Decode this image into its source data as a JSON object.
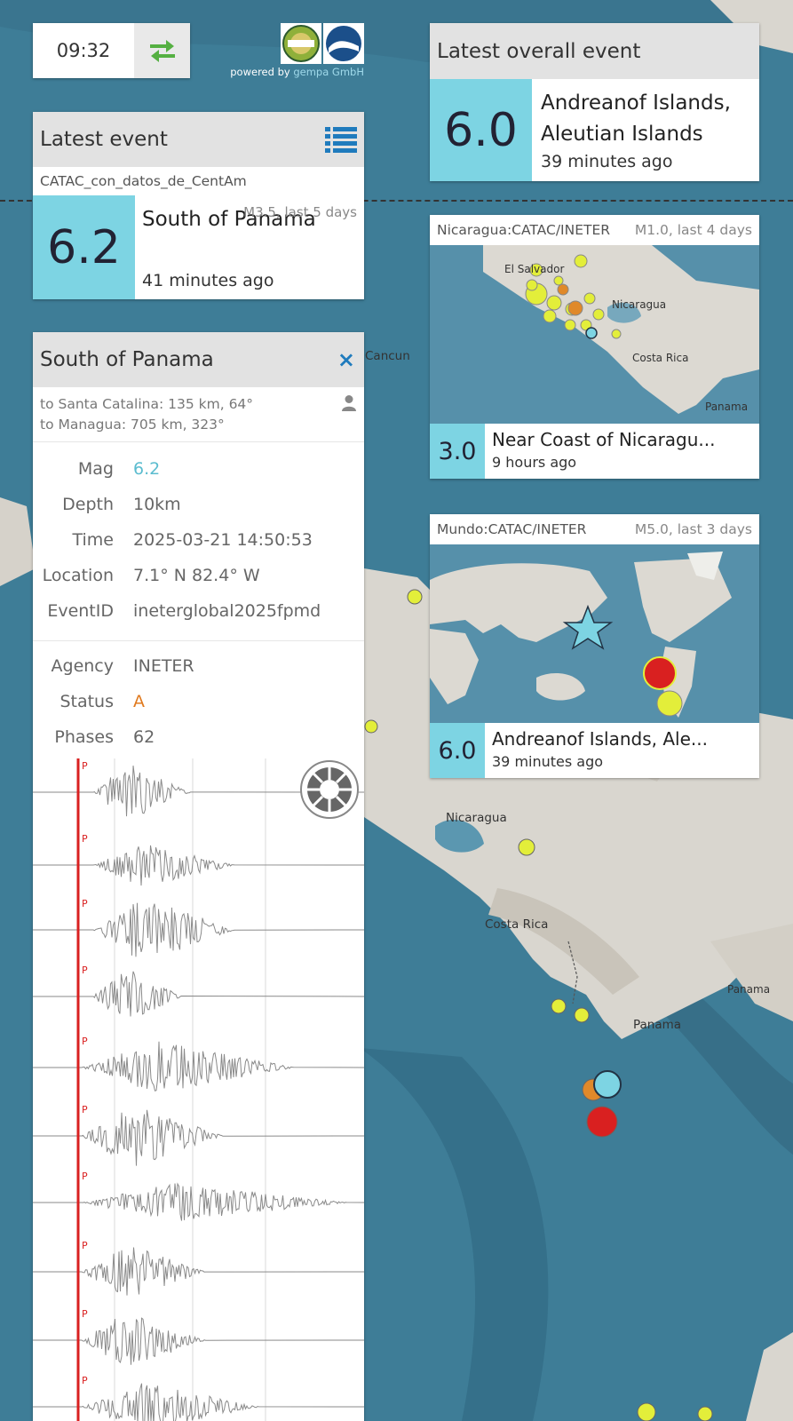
{
  "clock": {
    "time": "09:32",
    "swap_icon": "swap-arrows-icon"
  },
  "branding": {
    "powered_prefix": "powered by",
    "powered_brand": "gempa GmbH",
    "logo1": "ineter",
    "logo2_line1": "TSUNAMI",
    "logo2_line2": "CATAC"
  },
  "latest_event": {
    "title": "Latest event",
    "list_icon": "list-icon",
    "source": "CATAC_con_datos_de_CentAm",
    "magnitude": "6.2",
    "region": "South of Panama",
    "filter": "M3.5, last 5 days",
    "ago": "41 minutes ago"
  },
  "detail": {
    "title": "South of Panama",
    "close_label": "×",
    "distance1": "to Santa Catalina: 135 km, 64°",
    "distance2": "to Managua: 705 km, 323°",
    "rows1": [
      {
        "key": "Mag",
        "value": "6.2"
      },
      {
        "key": "Depth",
        "value": "10km"
      },
      {
        "key": "Time",
        "value": "2025-03-21 14:50:53"
      },
      {
        "key": "Location",
        "value": "7.1° N 82.4° W"
      },
      {
        "key": "EventID",
        "value": "ineterglobal2025fpmd"
      }
    ],
    "rows2": [
      {
        "key": "Agency",
        "value": "INETER"
      },
      {
        "key": "Status",
        "value": "A"
      },
      {
        "key": "Phases",
        "value": "62"
      }
    ],
    "phase_marker": "P"
  },
  "overall_event": {
    "title": "Latest overall event",
    "magnitude": "6.0",
    "region_line1": "Andreanof Islands,",
    "region_line2": "Aleutian Islands",
    "ago": "39 minutes ago"
  },
  "nicaragua_panel": {
    "source": "Nicaragua:CATAC/INETER",
    "filter": "M1.0, last 4 days",
    "magnitude": "3.0",
    "region": "Near Coast of Nicaragu...",
    "ago": "9 hours ago",
    "labels": {
      "salvador": "El Salvador",
      "nicaragua": "Nicaragua",
      "costarica": "Costa Rica",
      "panama": "Panama"
    }
  },
  "mundo_panel": {
    "source": "Mundo:CATAC/INETER",
    "filter": "M5.0, last 3 days",
    "magnitude": "6.0",
    "region": "Andreanof Islands, Ale...",
    "ago": "39 minutes ago"
  },
  "map_labels": {
    "cancun": "Cancun",
    "nicaragua": "Nicaragua",
    "costa_rica": "Costa Rica",
    "panama": "Panama",
    "panama2": "Panama"
  },
  "colors": {
    "magnitude_bg": "#7dd4e3",
    "status_orange": "#e07a1f",
    "mag_blue": "#5bbccf",
    "pick_red": "#d92020"
  }
}
